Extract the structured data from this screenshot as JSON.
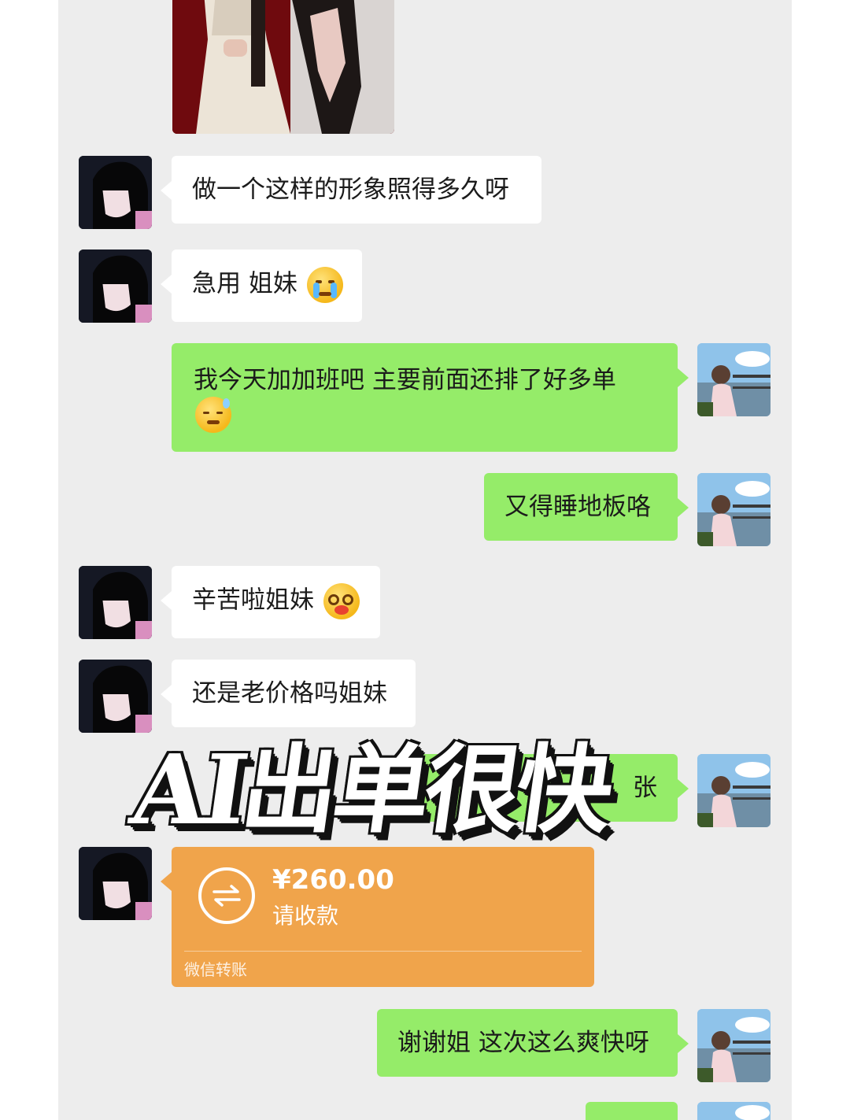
{
  "messages": {
    "m1": {
      "text": "做一个这样的形象照得多久呀"
    },
    "m2": {
      "text": "急用 姐妹"
    },
    "m3": {
      "line1": "我今天加加班吧 主要前面还排了好多单"
    },
    "m4": {
      "text": "又得睡地板咯"
    },
    "m5": {
      "text": "辛苦啦姐妹"
    },
    "m6": {
      "text": "还是老价格吗姐妹"
    },
    "m7": {
      "partial_text": "张"
    },
    "m9": {
      "text": "谢谢姐 这次这么爽快呀"
    }
  },
  "transfer": {
    "amount": "¥260.00",
    "status": "请收款",
    "label": "微信转账"
  },
  "overlay": {
    "text": "AI出单很快"
  },
  "icons": {
    "m2_emoji": "crying-emoji-icon",
    "m3_emoji": "sweat-emoji-icon",
    "m5_emoji": "blushing-emoji-icon",
    "transfer_icon": "transfer-arrows-icon"
  },
  "colors": {
    "background": "#ededed",
    "sent_bubble": "#95ec69",
    "received_bubble": "#ffffff",
    "transfer_card": "#f0a44b"
  }
}
